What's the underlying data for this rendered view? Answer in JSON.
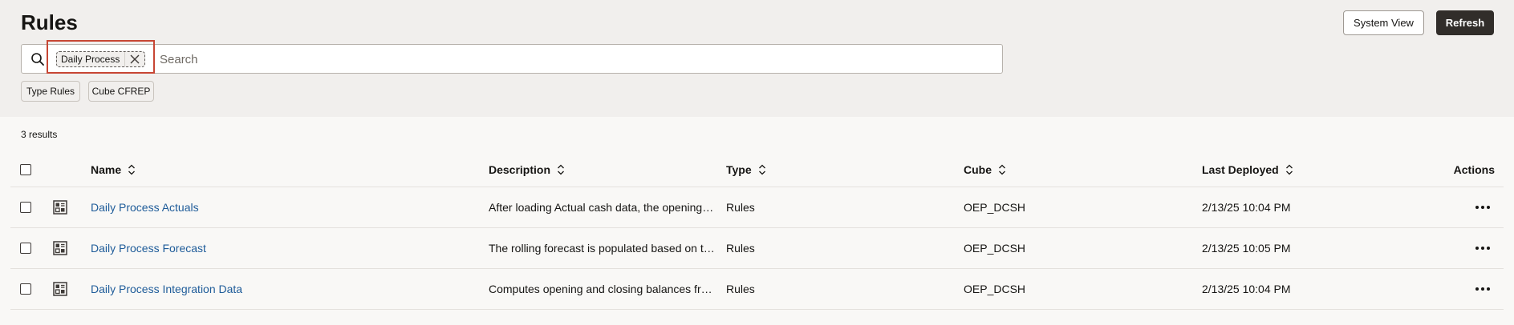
{
  "page": {
    "title": "Rules"
  },
  "toolbar": {
    "system_view_label": "System View",
    "refresh_label": "Refresh"
  },
  "search": {
    "placeholder": "Search",
    "value": "",
    "active_chip": "Daily Process"
  },
  "filters": [
    {
      "label": "Type Rules"
    },
    {
      "label": "Cube CFREP"
    }
  ],
  "results_count": "3 results",
  "table": {
    "columns": {
      "name": "Name",
      "description": "Description",
      "type": "Type",
      "cube": "Cube",
      "last_deployed": "Last Deployed",
      "actions": "Actions"
    },
    "rows": [
      {
        "name": "Daily Process Actuals",
        "description": "After loading Actual cash data, the opening and closing balances are computed",
        "type": "Rules",
        "cube": "OEP_DCSH",
        "last_deployed": "2/13/25 10:04 PM"
      },
      {
        "name": "Daily Process Forecast",
        "description": "The rolling forecast is populated based on the forecast data",
        "type": "Rules",
        "cube": "OEP_DCSH",
        "last_deployed": "2/13/25 10:05 PM"
      },
      {
        "name": "Daily Process Integration Data",
        "description": "Computes opening and closing balances from integration data",
        "type": "Rules",
        "cube": "OEP_DCSH",
        "last_deployed": "2/13/25 10:04 PM"
      }
    ]
  },
  "colors": {
    "header_bg": "#f1efed",
    "page_bg": "#f9f8f6",
    "link": "#1f5c99",
    "highlight": "#c74634",
    "primary_button": "#312d2a"
  },
  "icons": {
    "search": "search-icon",
    "chip_close": "close-icon",
    "rule_type": "rule-grid-icon",
    "sort": "sort-icon",
    "row_actions": "more-horizontal-icon"
  }
}
